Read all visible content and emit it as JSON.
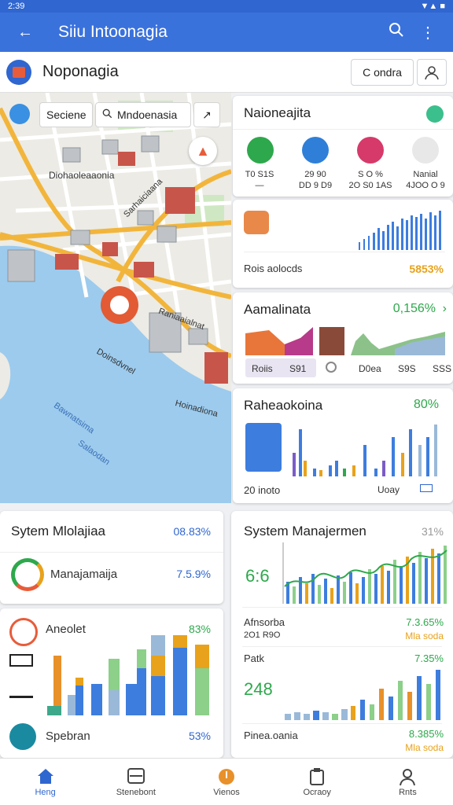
{
  "status": {
    "time": "2:39",
    "right": "▼▲ ■"
  },
  "appbar": {
    "title": "Siiu Intoonagia"
  },
  "subbar": {
    "name": "Noponagia",
    "button_label": "C ondra"
  },
  "map": {
    "chip_left": "Seciene",
    "search_text": "Mndoenasia",
    "labels": {
      "l1": "Diohaoleaaonia",
      "l2": "Sarhaiciaana",
      "l3": "Raniaaialnat",
      "l4": "Hoinadiona",
      "l5": "Doinsdvnel",
      "l6": "Bawnatsima",
      "l7": "Salaodan"
    }
  },
  "card1": {
    "title": "Naioneajita",
    "items": [
      {
        "l1": "T0 S1S",
        "l2": "—"
      },
      {
        "l1": "29 90",
        "l2": "DD 9 D9"
      },
      {
        "l1": "S O %",
        "l2": "2O S0 1AS"
      },
      {
        "l1": "Nanial",
        "l2": "4JOO O 9"
      }
    ]
  },
  "card2": {
    "label": "Rois aolocds",
    "value": "5853%"
  },
  "card3": {
    "title": "Aamalinata",
    "value": "0,156%",
    "labels": [
      "Roiis",
      "S91",
      "D0ea",
      "S9S",
      "SSS"
    ]
  },
  "card4": {
    "title": "Raheaokoina",
    "value": "80%",
    "bottom": "20 inoto",
    "right": "Uoay"
  },
  "card5": {
    "title": "Sytem Mlolajiaa",
    "value": "08.83%",
    "row_label": "Manajamaija",
    "row_value": "7.5.9%"
  },
  "card6": {
    "label_top": "Aneolet",
    "value_top": "83%",
    "label_bottom": "Spebran",
    "value_bottom": "53%"
  },
  "card7": {
    "title": "System Manajermen",
    "value": "31%",
    "big1": "6:6",
    "r1_label": "Afnsorba",
    "r1_sub": "2O1 R9O",
    "r1_value": "7.3.65%",
    "r1_value2": "Mla soda",
    "r2_label": "Patk",
    "r2_value": "7.35%",
    "big2": "248",
    "r3_label": "Pinea.oania",
    "r3_value": "8.385%",
    "r3_value2": "Mla soda"
  },
  "nav": [
    {
      "label": "Heng",
      "icon": "home-icon"
    },
    {
      "label": "Stenebont",
      "icon": "storage-icon"
    },
    {
      "label": "Vienos",
      "icon": "compass-icon"
    },
    {
      "label": "Ocraoy",
      "icon": "clipboard-icon"
    },
    {
      "label": "Rnts",
      "icon": "person-icon"
    }
  ],
  "colors": {
    "primary": "#3a72dc",
    "green": "#2ea84c",
    "orange": "#e8a21b",
    "water": "#9ccbee"
  }
}
